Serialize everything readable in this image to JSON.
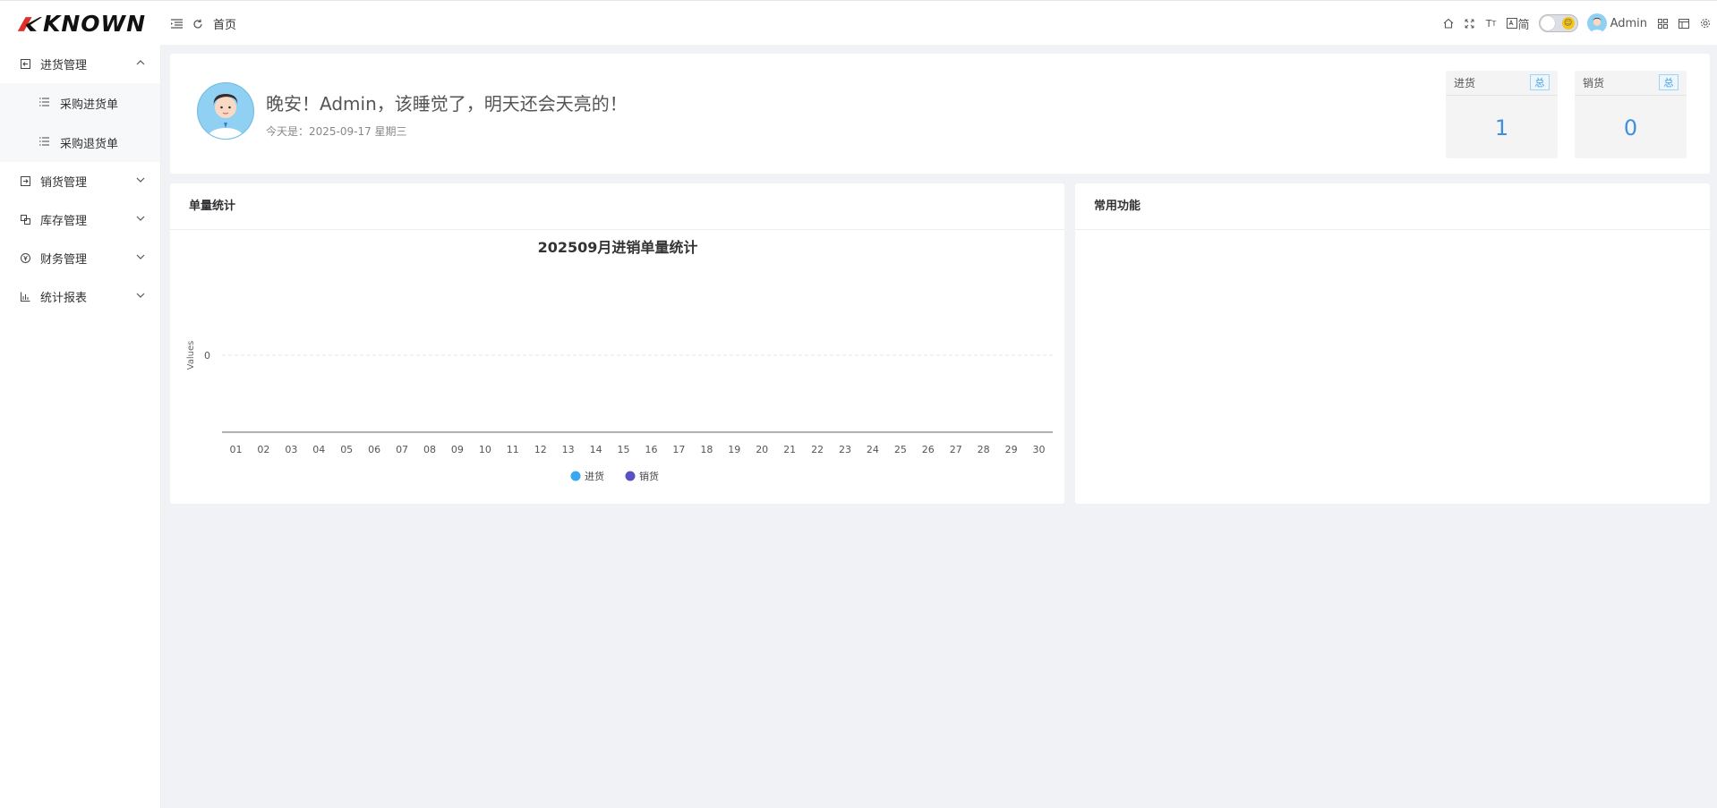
{
  "brand": {
    "logo_text": "KNOWN",
    "accent": "#e0302a"
  },
  "header": {
    "menu_toggle_icon": "menu-fold-icon",
    "refresh_icon": "refresh-icon",
    "breadcrumb": "首页",
    "right": {
      "lang_label": "简",
      "username": "Admin"
    }
  },
  "sidebar": {
    "groups": [
      {
        "label": "进货管理",
        "icon": "import-icon",
        "expanded": true,
        "children": [
          {
            "label": "采购进货单"
          },
          {
            "label": "采购退货单"
          }
        ]
      },
      {
        "label": "销货管理",
        "icon": "export-icon",
        "expanded": false
      },
      {
        "label": "库存管理",
        "icon": "inventory-icon",
        "expanded": false
      },
      {
        "label": "财务管理",
        "icon": "finance-icon",
        "expanded": false
      },
      {
        "label": "统计报表",
        "icon": "bar-chart-icon",
        "expanded": false
      }
    ]
  },
  "welcome": {
    "greeting": "晚安！Admin，该睡觉了，明天还会天亮的！",
    "date": "今天是：2025-09-17 星期三"
  },
  "stats": [
    {
      "title": "进货",
      "tag": "总",
      "value": "1"
    },
    {
      "title": "销货",
      "tag": "总",
      "value": "0"
    }
  ],
  "chart_card": {
    "title": "单量统计"
  },
  "func_card": {
    "title": "常用功能"
  },
  "chart_data": {
    "type": "bar",
    "title": "202509月进销单量统计",
    "ylabel": "Values",
    "categories": [
      "01",
      "02",
      "03",
      "04",
      "05",
      "06",
      "07",
      "08",
      "09",
      "10",
      "11",
      "12",
      "13",
      "14",
      "15",
      "16",
      "17",
      "18",
      "19",
      "20",
      "21",
      "22",
      "23",
      "24",
      "25",
      "26",
      "27",
      "28",
      "29",
      "30"
    ],
    "yticks": [
      0
    ],
    "series": [
      {
        "name": "进货",
        "color": "#3aa8f0",
        "values": [
          0,
          0,
          0,
          0,
          0,
          0,
          0,
          0,
          0,
          0,
          0,
          0,
          0,
          0,
          0,
          0,
          0,
          0,
          0,
          0,
          0,
          0,
          0,
          0,
          0,
          0,
          0,
          0,
          0,
          0
        ]
      },
      {
        "name": "销货",
        "color": "#5b4fc4",
        "values": [
          0,
          0,
          0,
          0,
          0,
          0,
          0,
          0,
          0,
          0,
          0,
          0,
          0,
          0,
          0,
          0,
          0,
          0,
          0,
          0,
          0,
          0,
          0,
          0,
          0,
          0,
          0,
          0,
          0,
          0
        ]
      }
    ],
    "legend": "bottom-center"
  }
}
